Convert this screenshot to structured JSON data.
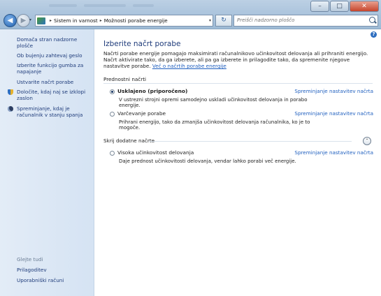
{
  "window": {
    "caption_buttons": {
      "minimize": "–",
      "maximize": "□",
      "close": "✕"
    }
  },
  "nav": {
    "back_glyph": "◀",
    "forward_glyph": "▶",
    "dropdown_glyph": "▾",
    "breadcrumb": [
      "Sistem in varnost",
      "Možnosti porabe energije"
    ],
    "crumb_separator": "▸",
    "address_dropdown_glyph": "▾",
    "refresh_glyph": "↻",
    "search_placeholder": "Preišči nadzorno ploščo"
  },
  "sidebar": {
    "home": "Domača stran nadzorne plošče",
    "links": [
      "Ob bujenju zahtevaj geslo",
      "Izberite funkcijo gumba za napajanje",
      "Ustvarite načrt porabe",
      "Določite, kdaj naj se izklopi zaslon",
      "Spreminjanje, kdaj je računalnik v stanju spanja"
    ],
    "see_also": "Glejte tudi",
    "see_also_links": [
      "Prilagoditev",
      "Uporabniški računi"
    ]
  },
  "main": {
    "help_glyph": "?",
    "title": "Izberite načrt porabe",
    "intro": "Načrti porabe energije pomagajo maksimirati računalnikovo učinkovitost delovanja ali prihraniti energijo. Načrt aktivirate tako, da ga izberete, ali pa ga izberete in prilagodite tako, da spremenite njegove nastavitve porabe.",
    "intro_link": "Več o načrtih porabe energije",
    "preferred_label": "Prednostni načrti",
    "plans": [
      {
        "name": "Usklajeno (priporočeno)",
        "description": "V ustrezni strojni opremi samodejno uskladi učinkovitost delovanja in porabo energije.",
        "link": "Spreminjanje nastavitev načrta",
        "selected": true
      },
      {
        "name": "Varčevanje porabe",
        "description": "Prihrani energijo, tako da zmanjša učinkovitost delovanja računalnika, ko je to mogoče.",
        "link": "Spreminjanje nastavitev načrta",
        "selected": false
      }
    ],
    "additional_label": "Skrij dodatne načrte",
    "collapse_glyph": "⌃",
    "additional_plans": [
      {
        "name": "Visoka učinkovitost delovanja",
        "description": "Daje prednost učinkovitosti delovanja, vendar lahko porabi več energije.",
        "link": "Spreminjanje nastavitev načrta",
        "selected": false
      }
    ]
  },
  "colors": {
    "link": "#1f5fbf",
    "sidebar_bg": "#dde8f5",
    "title": "#1e3b7a"
  }
}
